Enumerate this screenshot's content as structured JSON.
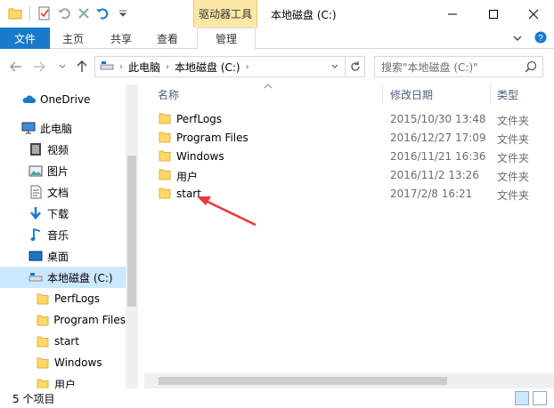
{
  "window": {
    "title": "本地磁盘 (C:)",
    "context_tab": "驱动器工具",
    "controls": {
      "minimize": "—",
      "maximize": "☐",
      "close": "✕"
    }
  },
  "ribbon": {
    "file_tab": "文件",
    "tabs": [
      "主页",
      "共享",
      "查看"
    ],
    "active_tab": "管理"
  },
  "address": {
    "crumbs": [
      "此电脑",
      "本地磁盘 (C:)"
    ],
    "search_placeholder": "搜索\"本地磁盘 (C:)\""
  },
  "nav": {
    "items": [
      {
        "label": "OneDrive",
        "icon": "cloud-icon"
      },
      {
        "label": "此电脑",
        "icon": "computer-icon"
      },
      {
        "label": "视频",
        "icon": "video-icon"
      },
      {
        "label": "图片",
        "icon": "picture-icon"
      },
      {
        "label": "文档",
        "icon": "document-icon"
      },
      {
        "label": "下载",
        "icon": "download-icon"
      },
      {
        "label": "音乐",
        "icon": "music-icon"
      },
      {
        "label": "桌面",
        "icon": "desktop-icon"
      },
      {
        "label": "本地磁盘 (C:)",
        "icon": "drive-icon"
      },
      {
        "label": "PerfLogs",
        "icon": "folder-icon"
      },
      {
        "label": "Program Files",
        "icon": "folder-icon"
      },
      {
        "label": "start",
        "icon": "folder-icon"
      },
      {
        "label": "Windows",
        "icon": "folder-icon"
      },
      {
        "label": "用户",
        "icon": "folder-icon"
      }
    ]
  },
  "columns": {
    "name": "名称",
    "date": "修改日期",
    "type": "类型"
  },
  "files": [
    {
      "name": "PerfLogs",
      "date": "2015/10/30 13:48",
      "type": "文件夹"
    },
    {
      "name": "Program Files",
      "date": "2016/12/27 17:09",
      "type": "文件夹"
    },
    {
      "name": "Windows",
      "date": "2016/11/21 16:36",
      "type": "文件夹"
    },
    {
      "name": "用户",
      "date": "2016/11/2 13:26",
      "type": "文件夹"
    },
    {
      "name": "start",
      "date": "2017/2/8 16:21",
      "type": "文件夹"
    }
  ],
  "status": {
    "count": "5 个项目"
  },
  "colors": {
    "accent": "#1979ca",
    "selection": "#cce8ff",
    "context": "#fce8a6",
    "folder": "#ffd867",
    "arrow": "#e8393f"
  }
}
